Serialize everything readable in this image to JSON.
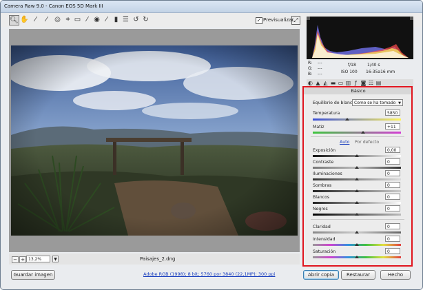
{
  "window": {
    "title": "Camera Raw 9.0 -  Canon EOS 5D Mark III"
  },
  "toolbar": {
    "preview_label": "Previsualizar",
    "preview_checked": "✓"
  },
  "image": {
    "zoom": "13,2%",
    "filename": "Paisajes_2.dng"
  },
  "readout": {
    "r_label": "R:",
    "g_label": "G:",
    "b_label": "B:",
    "r_val": "---",
    "g_val": "---",
    "b_val": "---",
    "aperture": "f/18",
    "shutter": "1/40 s",
    "iso": "ISO 100",
    "lens": "16-35a16 mm"
  },
  "panel": {
    "title": "Básico",
    "wb_label": "Equilibrio de blancos:",
    "wb_value": "Como se ha tomado",
    "auto_link": "Auto",
    "default_link": "Por defecto",
    "sliders": [
      {
        "label": "Temperatura",
        "value": "5850",
        "fraction": 0.5
      },
      {
        "label": "Matiz",
        "value": "+11",
        "fraction": 0.55
      },
      {
        "label": "Exposición",
        "value": "0,00",
        "fraction": 0.5
      },
      {
        "label": "Contraste",
        "value": "0",
        "fraction": 0.5
      },
      {
        "label": "Iluminaciones",
        "value": "0",
        "fraction": 0.5
      },
      {
        "label": "Sombras",
        "value": "0",
        "fraction": 0.5
      },
      {
        "label": "Blancos",
        "value": "0",
        "fraction": 0.5
      },
      {
        "label": "Negros",
        "value": "0",
        "fraction": 0.5
      },
      {
        "label": "Claridad",
        "value": "0",
        "fraction": 0.5
      },
      {
        "label": "Intensidad",
        "value": "0",
        "fraction": 0.5
      },
      {
        "label": "Saturación",
        "value": "0",
        "fraction": 0.5
      }
    ]
  },
  "footer": {
    "save_label": "Guardar imagen",
    "info_link": "Adobe RGB (1998); 8 bit; 5760 por 3840 (22,1MP); 300 ppi",
    "open_label": "Abrir copia",
    "reset_label": "Restaurar",
    "done_label": "Hecho"
  },
  "colors": {
    "highlight_box": "#e0141e",
    "link": "#1a3fbe"
  }
}
